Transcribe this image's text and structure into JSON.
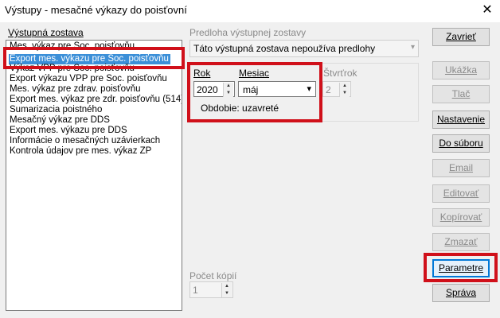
{
  "window": {
    "title": "Výstupy - mesačné výkazy do poisťovní",
    "close_glyph": "✕"
  },
  "report_list": {
    "label": "Výstupná zostava",
    "items": [
      "Mes. výkaz pre Soc. poisťovňu",
      "Export mes. výkazu pre Soc. poisťovňu",
      "Výkaz VPP pre Soc. poisťovňu",
      "Export výkazu VPP pre Soc. poisťovňu",
      "Mes. výkaz pre zdrav. poisťovňu",
      "Export mes. výkaz pre zdr. poisťovňu (514)",
      "Sumarizacia poistného",
      "Mesačný výkaz pre DDS",
      "Export mes. výkazu pre DDS",
      "Informácie o mesačných uzávierkach",
      "Kontrola údajov pre mes. výkaz ZP"
    ]
  },
  "template": {
    "label": "Predloha výstupnej zostavy",
    "value": "Táto výstupná zostava nepoužíva predlohy"
  },
  "period": {
    "year_label": "Rok",
    "year_value": "2020",
    "month_label": "Mesiac",
    "month_value": "máj",
    "quarter_label": "Štvrťrok",
    "quarter_value": "2",
    "status_text": "Obdobie: uzavreté"
  },
  "copies": {
    "label": "Počet kópií",
    "value": "1"
  },
  "buttons": {
    "close": "Zavrieť",
    "preview": "Ukážka",
    "print": "Tlač",
    "settings": "Nastavenie",
    "to_file": "Do súboru",
    "email": "Email",
    "edit": "Editovať",
    "copy": "Kopírovať",
    "delete": "Zmazať",
    "parameters": "Parametre",
    "manage": "Správa"
  },
  "icons": {
    "dropdown": "▾",
    "spin_up": "▲",
    "spin_down": "▼"
  },
  "colors": {
    "highlight": "#d0101a",
    "selection": "#3b8fd8",
    "default_button_border": "#0078d7"
  }
}
